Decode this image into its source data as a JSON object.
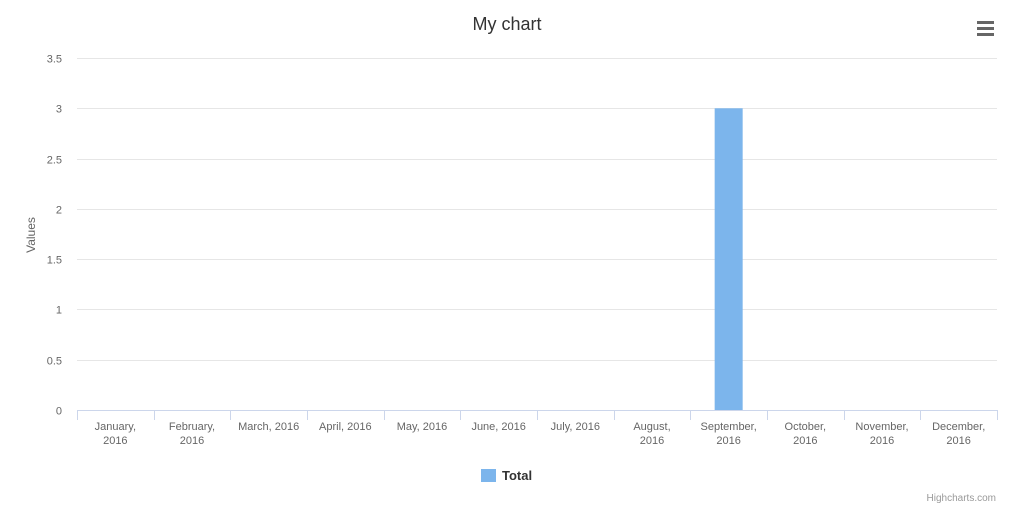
{
  "chart_data": {
    "type": "bar",
    "title": "My chart",
    "ylabel": "Values",
    "xlabel": "",
    "ylim": [
      0,
      3.5
    ],
    "y_ticks": [
      "0",
      "0.5",
      "1",
      "1.5",
      "2",
      "2.5",
      "3",
      "3.5"
    ],
    "categories": [
      "January, 2016",
      "February, 2016",
      "March, 2016",
      "April, 2016",
      "May, 2016",
      "June, 2016",
      "July, 2016",
      "August, 2016",
      "September, 2016",
      "October, 2016",
      "November, 2016",
      "December, 2016"
    ],
    "series": [
      {
        "name": "Total",
        "color": "#7cb5ec",
        "values": [
          0,
          0,
          0,
          0,
          0,
          0,
          0,
          0,
          3,
          0,
          0,
          0
        ]
      }
    ],
    "grid": true,
    "legend_position": "bottom-center"
  },
  "menu": {
    "icon": "hamburger-menu-icon"
  },
  "credits": "Highcharts.com"
}
